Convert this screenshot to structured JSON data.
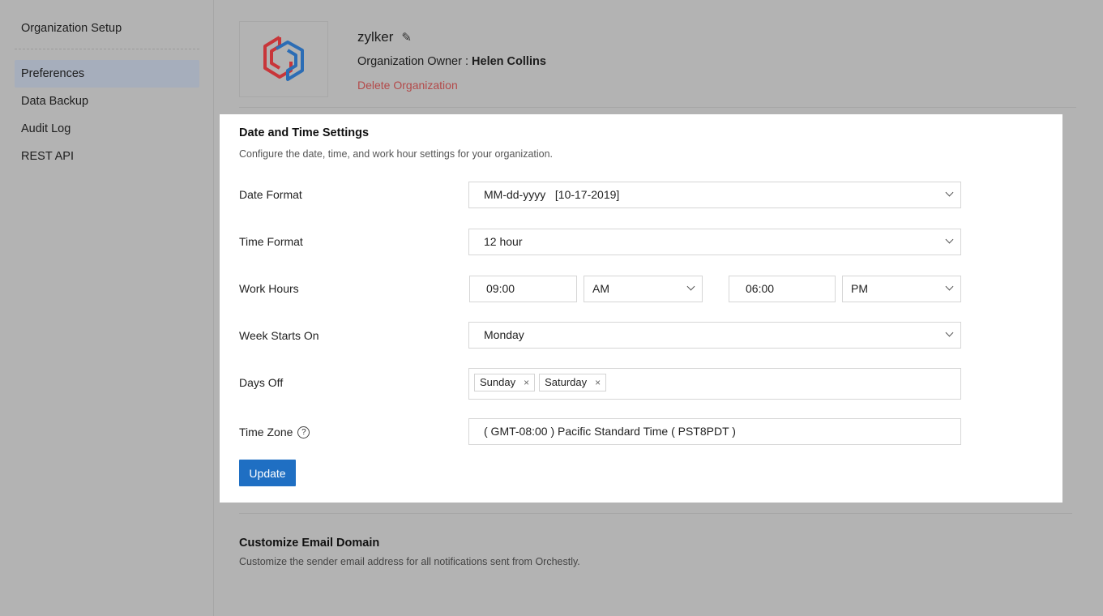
{
  "sidebar": {
    "heading": "Organization Setup",
    "items": [
      {
        "label": "Preferences",
        "active": true
      },
      {
        "label": "Data Backup"
      },
      {
        "label": "Audit Log"
      },
      {
        "label": "REST API"
      }
    ]
  },
  "org": {
    "name": "zylker",
    "owner_label": "Organization Owner :",
    "owner_name": "Helen Collins",
    "delete_label": "Delete Organization",
    "logo_colors": {
      "red": "#c8363a",
      "blue": "#2c6db5"
    }
  },
  "datetime": {
    "title": "Date and Time Settings",
    "description": "Configure the date, time, and work hour settings for your organization.",
    "date_format": {
      "label": "Date Format",
      "value": "MM-dd-yyyy   [10-17-2019]"
    },
    "time_format": {
      "label": "Time Format",
      "value": "12 hour"
    },
    "work_hours": {
      "label": "Work Hours",
      "start_time": "09:00",
      "start_period": "AM",
      "end_time": "06:00",
      "end_period": "PM"
    },
    "week_start": {
      "label": "Week Starts On",
      "value": "Monday"
    },
    "days_off": {
      "label": "Days Off",
      "tags": [
        "Sunday",
        "Saturday"
      ],
      "remove_glyph": "×"
    },
    "time_zone": {
      "label": "Time Zone",
      "help_glyph": "?",
      "value": "( GMT-08:00 ) Pacific Standard Time ( PST8PDT )"
    },
    "update_label": "Update"
  },
  "email_domain": {
    "title": "Customize Email Domain",
    "description": "Customize the sender email address for all notifications sent from Orchestly."
  },
  "icons": {
    "edit": "pencil-icon",
    "help": "help-icon",
    "dropdown": "chevron-down-icon",
    "remove": "close-icon"
  },
  "colors": {
    "primary_button": "#1f6fc3",
    "delete_link": "#b34a4a",
    "active_nav": "#a6aebc"
  }
}
